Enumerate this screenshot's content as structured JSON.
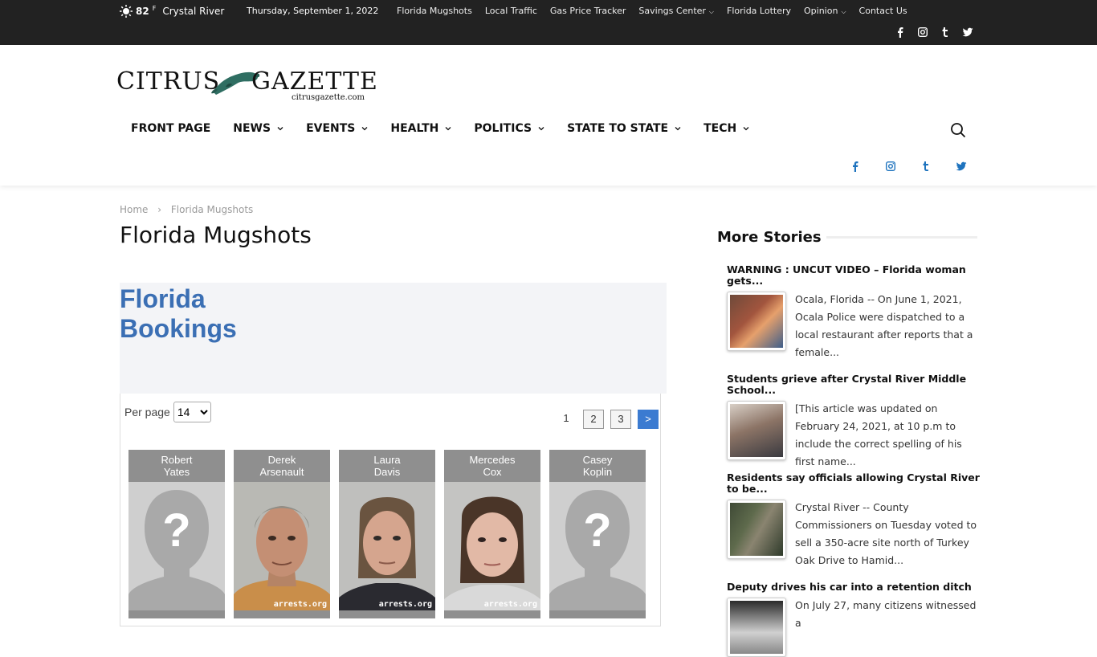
{
  "topbar": {
    "weather_icon": "sun-icon",
    "temp": "82",
    "temp_unit": "F",
    "city": "Crystal River",
    "date": "Thursday, September 1, 2022",
    "nav": [
      {
        "label": "Florida Mugshots",
        "active": true
      },
      {
        "label": "Local Traffic"
      },
      {
        "label": "Gas Price Tracker"
      },
      {
        "label": "Savings Center",
        "dropdown": true
      },
      {
        "label": "Florida Lottery"
      },
      {
        "label": "Opinion",
        "dropdown": true
      },
      {
        "label": "Contact Us"
      }
    ],
    "social": [
      "facebook-icon",
      "instagram-icon",
      "tumblr-icon",
      "twitter-icon"
    ]
  },
  "logo": {
    "word1": "CITRUS",
    "word2": "GAZETTE",
    "domain": "citrusgazette.com"
  },
  "mainnav": [
    {
      "label": "FRONT PAGE",
      "dropdown": false
    },
    {
      "label": "NEWS",
      "dropdown": true
    },
    {
      "label": "EVENTS",
      "dropdown": true
    },
    {
      "label": "HEALTH",
      "dropdown": true
    },
    {
      "label": "POLITICS",
      "dropdown": true
    },
    {
      "label": "STATE TO STATE",
      "dropdown": true
    },
    {
      "label": "TECH",
      "dropdown": true
    }
  ],
  "breadcrumb": {
    "home": "Home",
    "separator": "›",
    "current": "Florida Mugshots"
  },
  "page_title": "Florida Mugshots",
  "bookings": {
    "title": "Florida Bookings",
    "per_page_label": "Per page",
    "per_page_value": "14",
    "pages": [
      "1",
      "2",
      "3"
    ],
    "next_label": ">",
    "mugshots": [
      {
        "first": "Robert",
        "last": "Yates",
        "photo": "placeholder"
      },
      {
        "first": "Derek",
        "last": "Arsenault",
        "photo": "photo",
        "watermark": "arrests.org"
      },
      {
        "first": "Laura",
        "last": "Davis",
        "photo": "photo",
        "watermark": "arrests.org"
      },
      {
        "first": "Mercedes",
        "last": "Cox",
        "photo": "photo",
        "watermark": "arrests.org"
      },
      {
        "first": "Casey",
        "last": "Koplin",
        "photo": "placeholder"
      }
    ]
  },
  "sidebar": {
    "heading": "More Stories",
    "stories": [
      {
        "title": "WARNING : UNCUT VIDEO – Florida woman gets...",
        "excerpt": "Ocala, Florida -- On June 1, 2021, Ocala Police were dispatched to a local restaurant after reports that a female..."
      },
      {
        "title": "Students grieve after Crystal River Middle School...",
        "excerpt": "[This article was updated on February 24, 2021, at 10 p.m to include the correct spelling of his first name..."
      },
      {
        "title": "Residents say officials allowing Crystal River to be...",
        "excerpt": "Crystal River -- County Commissioners on Tuesday voted to sell a 350-acre site north of Turkey Oak Drive to Hamid..."
      },
      {
        "title": "Deputy drives his car into a retention ditch",
        "excerpt": "On July 27, many citizens witnessed a"
      }
    ]
  },
  "colors": {
    "accent": "#4db2ec",
    "brand_blue": "#1e73be",
    "bookings_blue": "#3b6fb4",
    "topbar": "#222222"
  }
}
